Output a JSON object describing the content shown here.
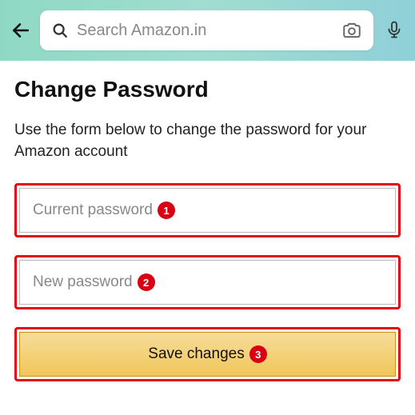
{
  "header": {
    "search_placeholder": "Search Amazon.in"
  },
  "page": {
    "title": "Change Password",
    "description": "Use the form below to change the password for your Amazon account"
  },
  "form": {
    "current_password_placeholder": "Current password",
    "new_password_placeholder": "New password",
    "save_label": "Save changes"
  },
  "annotations": {
    "badge1": "1",
    "badge2": "2",
    "badge3": "3"
  }
}
